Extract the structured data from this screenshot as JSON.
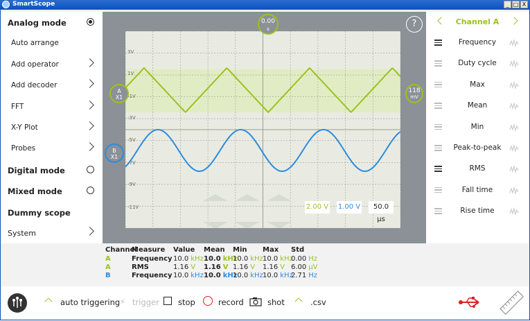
{
  "window": {
    "title": "SmartScope",
    "controls": [
      "_",
      "□",
      "X"
    ]
  },
  "left_menu": {
    "items": [
      {
        "label": "Analog mode",
        "style": "bold",
        "control": "radio",
        "selected": true
      },
      {
        "label": "Auto arrange",
        "style": "sub",
        "control": "none"
      },
      {
        "label": "Add operator",
        "style": "sub",
        "control": "chevron"
      },
      {
        "label": "Add decoder",
        "style": "sub",
        "control": "chevron"
      },
      {
        "label": "FFT",
        "style": "sub",
        "control": "chevron"
      },
      {
        "label": "X-Y Plot",
        "style": "sub",
        "control": "chevron"
      },
      {
        "label": "Probes",
        "style": "sub",
        "control": "chevron"
      },
      {
        "label": "Digital mode",
        "style": "bold",
        "control": "radio",
        "selected": false
      },
      {
        "label": "Mixed mode",
        "style": "bold",
        "control": "radio",
        "selected": false
      },
      {
        "label": "Dummy scope",
        "style": "bold",
        "control": "none"
      },
      {
        "label": "System",
        "style": "plain",
        "control": "chevron"
      }
    ]
  },
  "scope": {
    "trigger_time": "0.00",
    "trigger_time_unit": "s",
    "help_label": "?",
    "channel_a_marker": {
      "name": "A",
      "probe": "X1"
    },
    "channel_b_marker": {
      "name": "B",
      "probe": "X1"
    },
    "trigger_level": {
      "value": "118",
      "unit": "mV"
    },
    "axis_labels": [
      "3V",
      "1V",
      "-1V",
      "-3V",
      "-5V",
      "-7V",
      "-9V",
      "-11V"
    ],
    "scales": {
      "channel_a": "2.00 V",
      "channel_b": "1.00 V",
      "time": "50.0 µs"
    },
    "colors": {
      "channel_a": "#9bc21f",
      "channel_b": "#2b8be0",
      "grid_bg": "#e9ebe2",
      "surround": "#8b9196"
    }
  },
  "measurements": {
    "headers": [
      "Channel",
      "Measure",
      "Value",
      "Mean",
      "Min",
      "Max",
      "Std"
    ],
    "rows": [
      {
        "channel": "A",
        "measure": "Frequency",
        "value": "10.0",
        "value_unit": "kHz",
        "mean": "10.0",
        "mean_unit": "kHz",
        "min": "10.0",
        "min_unit": "kHz",
        "max": "10.0",
        "max_unit": "kHz",
        "std": "0.00",
        "std_unit": "Hz"
      },
      {
        "channel": "A",
        "measure": "RMS",
        "value": "1.16",
        "value_unit": "V",
        "mean": "1.16",
        "mean_unit": "V",
        "min": "1.16",
        "min_unit": "V",
        "max": "1.16",
        "max_unit": "V",
        "std": "6.00",
        "std_unit": "µV"
      },
      {
        "channel": "B",
        "measure": "Frequency",
        "value": "10.0",
        "value_unit": "kHz",
        "mean": "10.0",
        "mean_unit": "kHz",
        "min": "10.0",
        "min_unit": "kHz",
        "max": "10.0",
        "max_unit": "kHz",
        "std": "2.71",
        "std_unit": "Hz"
      }
    ]
  },
  "right_panel": {
    "channel_label": "Channel A",
    "items": [
      {
        "label": "Frequency",
        "active": true
      },
      {
        "label": "Duty cycle",
        "active": false
      },
      {
        "label": "Max",
        "active": false
      },
      {
        "label": "Mean",
        "active": false
      },
      {
        "label": "Min",
        "active": false
      },
      {
        "label": "Peak-to-peak",
        "active": false
      },
      {
        "label": "RMS",
        "active": true
      },
      {
        "label": "Fall time",
        "active": false
      },
      {
        "label": "Rise time",
        "active": false
      }
    ]
  },
  "bottom_bar": {
    "auto_triggering": "auto triggering",
    "trigger": "trigger",
    "stop": "stop",
    "record": "record",
    "shot": "shot",
    "csv": ".csv"
  }
}
